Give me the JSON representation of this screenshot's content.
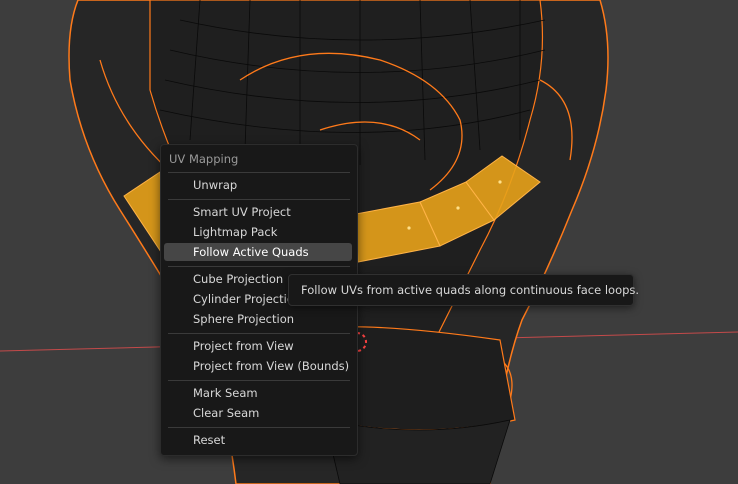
{
  "colors": {
    "viewport_bg": "#3d3d3d",
    "mesh_dark": "#1c1c1c",
    "mesh_edge": "#0a0a0a",
    "selection_outline": "#ff7a1a",
    "selected_faces": "#e8a21a",
    "axis_red": "#c44a4a",
    "menu_bg": "#181818",
    "menu_highlight": "#464646"
  },
  "menu": {
    "title": "UV Mapping",
    "items": [
      {
        "label": "Unwrap"
      },
      {
        "label": "Smart UV Project"
      },
      {
        "label": "Lightmap Pack"
      },
      {
        "label": "Follow Active Quads",
        "active": true
      },
      {
        "label": "Cube Projection"
      },
      {
        "label": "Cylinder Projection"
      },
      {
        "label": "Sphere Projection"
      },
      {
        "label": "Project from View"
      },
      {
        "label": "Project from View (Bounds)"
      },
      {
        "label": "Mark Seam"
      },
      {
        "label": "Clear Seam"
      },
      {
        "label": "Reset"
      }
    ]
  },
  "tooltip": {
    "text": "Follow UVs from active quads along continuous face loops."
  }
}
